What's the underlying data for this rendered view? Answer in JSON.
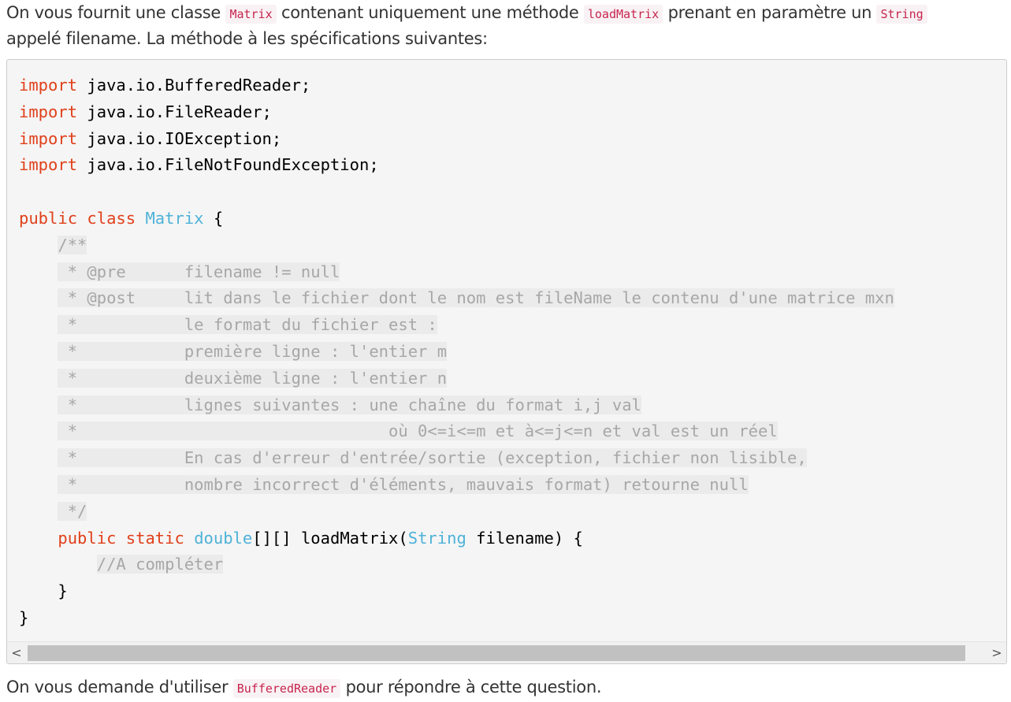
{
  "intro": {
    "l1_a": "On vous fournit une classe ",
    "l1_code1": "Matrix",
    "l1_b": " contenant uniquement une méthode ",
    "l1_code2": "loadMatrix",
    "l1_c": " prenant en paramètre un ",
    "l1_code3": "String",
    "l2": "appelé filename. La méthode à les spécifications suivantes:"
  },
  "code": {
    "imp1_kw": "import",
    "imp1_rest": " java.io.BufferedReader;",
    "imp2_kw": "import",
    "imp2_rest": " java.io.FileReader;",
    "imp3_kw": "import",
    "imp3_rest": " java.io.IOException;",
    "imp4_kw": "import",
    "imp4_rest": " java.io.FileNotFoundException;",
    "cls_kw1": "public",
    "cls_kw2": "class",
    "cls_name": "Matrix",
    "cls_brace": " {",
    "doc_open": "/**",
    "doc_pre": " * @pre      filename != null",
    "doc_post": " * @post     lit dans le fichier dont le nom est fileName le contenu d'une matrice mxn",
    "doc_l3": " *           le format du fichier est :",
    "doc_l4": " *           première ligne : l'entier m",
    "doc_l5": " *           deuxième ligne : l'entier n",
    "doc_l6": " *           lignes suivantes : une chaîne du format i,j val",
    "doc_l7": " *                                où 0<=i<=m et à<=j<=n et val est un réel",
    "doc_l8": " *           En cas d'erreur d'entrée/sortie (exception, fichier non lisible,",
    "doc_l9": " *           nombre incorrect d'éléments, mauvais format) retourne null",
    "doc_close": " */",
    "m_kw1": "public",
    "m_kw2": "static",
    "m_type": "double",
    "m_mid": "[][] loadMatrix(",
    "m_ptype": "String",
    "m_end": " filename) {",
    "todo": "//A compléter",
    "close_method": "}",
    "close_class": "}"
  },
  "scrollbar": {
    "left_arrow": "<",
    "right_arrow": ">"
  },
  "outro": {
    "a": "On vous demande d'utiliser ",
    "code": "BufferedReader",
    "b": " pour répondre à cette question."
  }
}
